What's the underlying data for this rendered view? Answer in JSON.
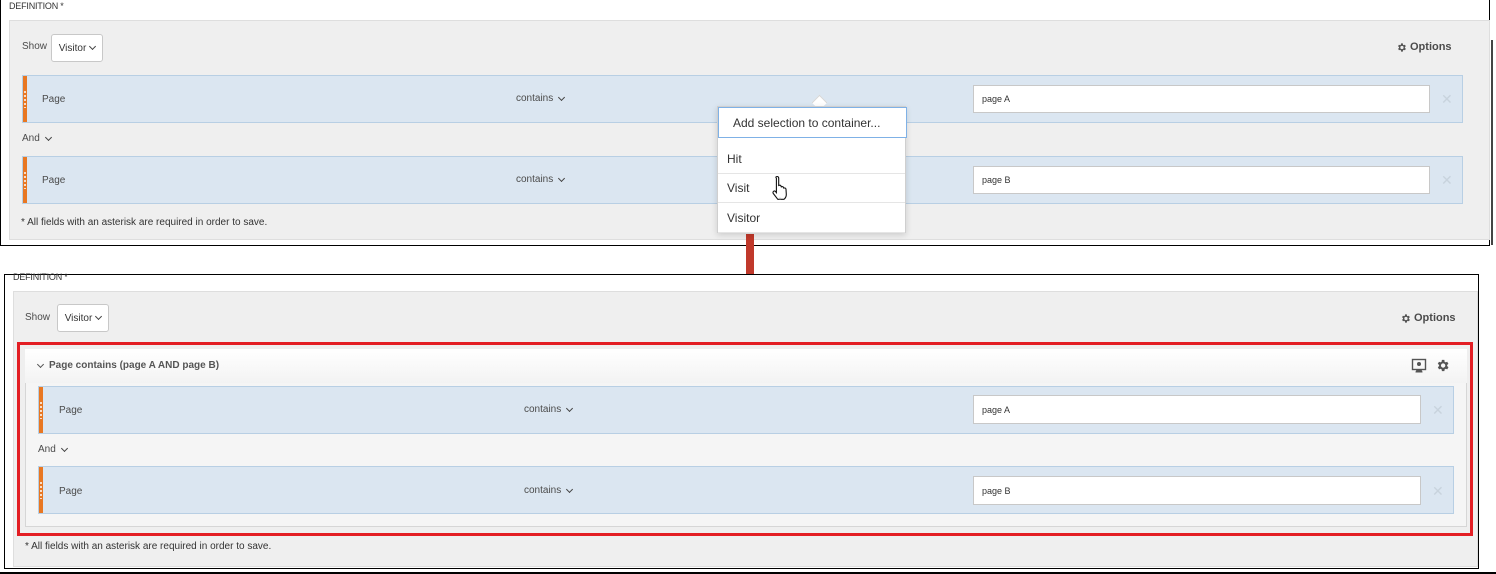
{
  "top": {
    "definition_label": "DEFINITION *",
    "show_label": "Show",
    "show_value": "Visitor",
    "options_label": "Options",
    "rules": [
      {
        "name": "Page",
        "operator": "contains",
        "value": "page A"
      },
      {
        "name": "Page",
        "operator": "contains",
        "value": "page B"
      }
    ],
    "conjunction": "And",
    "footnote": "* All fields with an asterisk are required in order to save."
  },
  "popup": {
    "head": "Add selection to container...",
    "items": [
      "Hit",
      "Visit",
      "Visitor"
    ]
  },
  "bottom": {
    "definition_label": "DEFINITION *",
    "show_label": "Show",
    "show_value": "Visitor",
    "options_label": "Options",
    "container_title": "Page contains (page A AND page B)",
    "rules": [
      {
        "name": "Page",
        "operator": "contains",
        "value": "page A"
      },
      {
        "name": "Page",
        "operator": "contains",
        "value": "page B"
      }
    ],
    "conjunction": "And",
    "footnote": "* All fields with an asterisk are required in order to save."
  },
  "colors": {
    "accent_handle": "#e87722",
    "arrow": "#c0392b",
    "highlight": "#e31e24",
    "rule_bg": "#dbe6f1"
  }
}
